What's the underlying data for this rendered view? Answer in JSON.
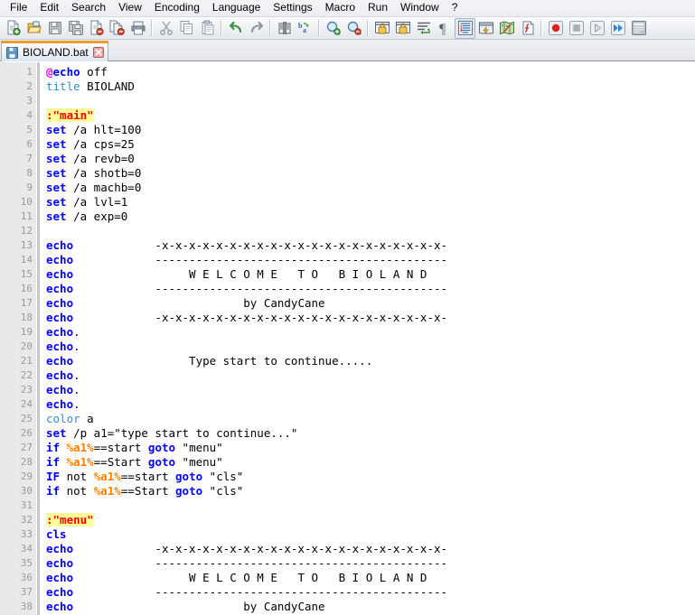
{
  "app": {
    "title": "Notepad++",
    "accent_orange": "#f09a2b",
    "label_color": "#ff0000",
    "keyword_color": "#0000ff",
    "variable_color": "#ff8000",
    "highlight_color": "#ffff99"
  },
  "menubar": {
    "items": [
      {
        "label": "File",
        "name": "menu-file"
      },
      {
        "label": "Edit",
        "name": "menu-edit"
      },
      {
        "label": "Search",
        "name": "menu-search"
      },
      {
        "label": "View",
        "name": "menu-view"
      },
      {
        "label": "Encoding",
        "name": "menu-encoding"
      },
      {
        "label": "Language",
        "name": "menu-language"
      },
      {
        "label": "Settings",
        "name": "menu-settings"
      },
      {
        "label": "Macro",
        "name": "menu-macro"
      },
      {
        "label": "Run",
        "name": "menu-run"
      },
      {
        "label": "Window",
        "name": "menu-window"
      },
      {
        "label": "?",
        "name": "menu-help"
      }
    ]
  },
  "toolbar": {
    "buttons": [
      {
        "icon": "new-file-icon",
        "tooltip": "New"
      },
      {
        "icon": "open-file-icon",
        "tooltip": "Open"
      },
      {
        "icon": "save-icon",
        "tooltip": "Save"
      },
      {
        "icon": "save-all-icon",
        "tooltip": "Save All"
      },
      {
        "icon": "close-file-icon",
        "tooltip": "Close"
      },
      {
        "icon": "close-all-files-icon",
        "tooltip": "Close All"
      },
      {
        "icon": "print-icon",
        "tooltip": "Print"
      },
      {
        "icon": "separator",
        "tooltip": ""
      },
      {
        "icon": "cut-icon",
        "tooltip": "Cut"
      },
      {
        "icon": "copy-icon",
        "tooltip": "Copy"
      },
      {
        "icon": "paste-icon",
        "tooltip": "Paste"
      },
      {
        "icon": "separator",
        "tooltip": ""
      },
      {
        "icon": "undo-icon",
        "tooltip": "Undo"
      },
      {
        "icon": "redo-icon",
        "tooltip": "Redo"
      },
      {
        "icon": "separator",
        "tooltip": ""
      },
      {
        "icon": "find-icon",
        "tooltip": "Find"
      },
      {
        "icon": "replace-icon",
        "tooltip": "Replace"
      },
      {
        "icon": "separator",
        "tooltip": ""
      },
      {
        "icon": "zoom-in-icon",
        "tooltip": "Zoom In"
      },
      {
        "icon": "zoom-out-icon",
        "tooltip": "Zoom Out"
      },
      {
        "icon": "separator",
        "tooltip": ""
      },
      {
        "icon": "sync-vertical-scroll-icon",
        "tooltip": "Synchronize Vertical Scrolling"
      },
      {
        "icon": "sync-horizontal-scroll-icon",
        "tooltip": "Synchronize Horizontal Scrolling"
      },
      {
        "icon": "word-wrap-icon",
        "tooltip": "Word Wrap"
      },
      {
        "icon": "show-all-chars-icon",
        "tooltip": "Show All Characters"
      },
      {
        "icon": "indent-guide-icon",
        "tooltip": "Show Indent Guide"
      },
      {
        "icon": "user-defined-dialog-icon",
        "tooltip": "User Defined Dialogue"
      },
      {
        "icon": "show-document-map-icon",
        "tooltip": "Document Map"
      },
      {
        "icon": "function-list-icon",
        "tooltip": "Function List"
      },
      {
        "icon": "separator",
        "tooltip": ""
      },
      {
        "icon": "record-macro-icon",
        "tooltip": "Start Recording"
      },
      {
        "icon": "stop-macro-icon",
        "tooltip": "Stop Recording"
      },
      {
        "icon": "play-macro-icon",
        "tooltip": "Playback"
      },
      {
        "icon": "run-macro-multiple-icon",
        "tooltip": "Run a Macro Multiple Times"
      },
      {
        "icon": "save-macro-icon",
        "tooltip": "Save Current Recorded Macro"
      }
    ]
  },
  "tabbar": {
    "tabs": [
      {
        "label": "BIOLAND.bat",
        "icon": "saved-file-icon",
        "close_icon": "close-icon",
        "active": true
      }
    ]
  },
  "editor": {
    "first_line": 1,
    "total_visible_lines": 38,
    "lines": [
      {
        "n": 1,
        "tokens": [
          {
            "t": "@",
            "c": "at"
          },
          {
            "t": "echo",
            "c": "k"
          },
          {
            "t": " off",
            "c": "txt"
          }
        ]
      },
      {
        "n": 2,
        "tokens": [
          {
            "t": "title",
            "c": "k2"
          },
          {
            "t": " BIOLAND",
            "c": "txt"
          }
        ]
      },
      {
        "n": 3,
        "tokens": []
      },
      {
        "n": 4,
        "tokens": [
          {
            "t": ":\"main\"",
            "c": "lbl"
          }
        ]
      },
      {
        "n": 5,
        "tokens": [
          {
            "t": "set",
            "c": "k"
          },
          {
            "t": " /a hlt=100",
            "c": "txt"
          }
        ]
      },
      {
        "n": 6,
        "tokens": [
          {
            "t": "set",
            "c": "k"
          },
          {
            "t": " /a cps=25",
            "c": "txt"
          }
        ]
      },
      {
        "n": 7,
        "tokens": [
          {
            "t": "set",
            "c": "k"
          },
          {
            "t": " /a revb=0",
            "c": "txt"
          }
        ]
      },
      {
        "n": 8,
        "tokens": [
          {
            "t": "set",
            "c": "k"
          },
          {
            "t": " /a shotb=0",
            "c": "txt"
          }
        ]
      },
      {
        "n": 9,
        "tokens": [
          {
            "t": "set",
            "c": "k"
          },
          {
            "t": " /a machb=0",
            "c": "txt"
          }
        ]
      },
      {
        "n": 10,
        "tokens": [
          {
            "t": "set",
            "c": "k"
          },
          {
            "t": " /a lvl=1",
            "c": "txt"
          }
        ]
      },
      {
        "n": 11,
        "tokens": [
          {
            "t": "set",
            "c": "k"
          },
          {
            "t": " /a exp=0",
            "c": "txt"
          }
        ]
      },
      {
        "n": 12,
        "tokens": []
      },
      {
        "n": 13,
        "tokens": [
          {
            "t": "echo",
            "c": "k"
          },
          {
            "t": "            -x-x-x-x-x-x-x-x-x-x-x-x-x-x-x-x-x-x-x-x-x-",
            "c": "txt"
          }
        ]
      },
      {
        "n": 14,
        "tokens": [
          {
            "t": "echo",
            "c": "k"
          },
          {
            "t": "            -------------------------------------------",
            "c": "txt"
          }
        ]
      },
      {
        "n": 15,
        "tokens": [
          {
            "t": "echo",
            "c": "k"
          },
          {
            "t": "                 W E L C O M E   T O   B I O L A N D",
            "c": "txt"
          }
        ]
      },
      {
        "n": 16,
        "tokens": [
          {
            "t": "echo",
            "c": "k"
          },
          {
            "t": "            -------------------------------------------",
            "c": "txt"
          }
        ]
      },
      {
        "n": 17,
        "tokens": [
          {
            "t": "echo",
            "c": "k"
          },
          {
            "t": "                         by CandyCane",
            "c": "txt"
          }
        ]
      },
      {
        "n": 18,
        "tokens": [
          {
            "t": "echo",
            "c": "k"
          },
          {
            "t": "            -x-x-x-x-x-x-x-x-x-x-x-x-x-x-x-x-x-x-x-x-x-",
            "c": "txt"
          }
        ]
      },
      {
        "n": 19,
        "tokens": [
          {
            "t": "echo",
            "c": "k"
          },
          {
            "t": ".",
            "c": "txt"
          }
        ]
      },
      {
        "n": 20,
        "tokens": [
          {
            "t": "echo",
            "c": "k"
          },
          {
            "t": ".",
            "c": "txt"
          }
        ]
      },
      {
        "n": 21,
        "tokens": [
          {
            "t": "echo",
            "c": "k"
          },
          {
            "t": "                 Type start to continue.....",
            "c": "txt"
          }
        ]
      },
      {
        "n": 22,
        "tokens": [
          {
            "t": "echo",
            "c": "k"
          },
          {
            "t": ".",
            "c": "txt"
          }
        ]
      },
      {
        "n": 23,
        "tokens": [
          {
            "t": "echo",
            "c": "k"
          },
          {
            "t": ".",
            "c": "txt"
          }
        ]
      },
      {
        "n": 24,
        "tokens": [
          {
            "t": "echo",
            "c": "k"
          },
          {
            "t": ".",
            "c": "txt"
          }
        ]
      },
      {
        "n": 25,
        "tokens": [
          {
            "t": "color",
            "c": "k2"
          },
          {
            "t": " a",
            "c": "txt"
          }
        ]
      },
      {
        "n": 26,
        "tokens": [
          {
            "t": "set",
            "c": "k"
          },
          {
            "t": " /p a1=\"type start to continue...\"",
            "c": "txt"
          }
        ]
      },
      {
        "n": 27,
        "tokens": [
          {
            "t": "if",
            "c": "k"
          },
          {
            "t": " ",
            "c": "txt"
          },
          {
            "t": "%a1%",
            "c": "var"
          },
          {
            "t": "==start ",
            "c": "txt"
          },
          {
            "t": "goto",
            "c": "k"
          },
          {
            "t": " \"menu\"",
            "c": "txt"
          }
        ]
      },
      {
        "n": 28,
        "tokens": [
          {
            "t": "if",
            "c": "k"
          },
          {
            "t": " ",
            "c": "txt"
          },
          {
            "t": "%a1%",
            "c": "var"
          },
          {
            "t": "==Start ",
            "c": "txt"
          },
          {
            "t": "goto",
            "c": "k"
          },
          {
            "t": " \"menu\"",
            "c": "txt"
          }
        ]
      },
      {
        "n": 29,
        "tokens": [
          {
            "t": "IF",
            "c": "k"
          },
          {
            "t": " not ",
            "c": "txt"
          },
          {
            "t": "%a1%",
            "c": "var"
          },
          {
            "t": "==start ",
            "c": "txt"
          },
          {
            "t": "goto",
            "c": "k"
          },
          {
            "t": " \"cls\"",
            "c": "txt"
          }
        ]
      },
      {
        "n": 30,
        "tokens": [
          {
            "t": "if",
            "c": "k"
          },
          {
            "t": " not ",
            "c": "txt"
          },
          {
            "t": "%a1%",
            "c": "var"
          },
          {
            "t": "==Start ",
            "c": "txt"
          },
          {
            "t": "goto",
            "c": "k"
          },
          {
            "t": " \"cls\"",
            "c": "txt"
          }
        ]
      },
      {
        "n": 31,
        "tokens": []
      },
      {
        "n": 32,
        "tokens": [
          {
            "t": ":\"menu\"",
            "c": "lbl"
          }
        ]
      },
      {
        "n": 33,
        "tokens": [
          {
            "t": "cls",
            "c": "k"
          }
        ]
      },
      {
        "n": 34,
        "tokens": [
          {
            "t": "echo",
            "c": "k"
          },
          {
            "t": "            -x-x-x-x-x-x-x-x-x-x-x-x-x-x-x-x-x-x-x-x-x-",
            "c": "txt"
          }
        ]
      },
      {
        "n": 35,
        "tokens": [
          {
            "t": "echo",
            "c": "k"
          },
          {
            "t": "            -------------------------------------------",
            "c": "txt"
          }
        ]
      },
      {
        "n": 36,
        "tokens": [
          {
            "t": "echo",
            "c": "k"
          },
          {
            "t": "                 W E L C O M E   T O   B I O L A N D",
            "c": "txt"
          }
        ]
      },
      {
        "n": 37,
        "tokens": [
          {
            "t": "echo",
            "c": "k"
          },
          {
            "t": "            -------------------------------------------",
            "c": "txt"
          }
        ]
      },
      {
        "n": 38,
        "tokens": [
          {
            "t": "echo",
            "c": "k"
          },
          {
            "t": "                         by CandyCane",
            "c": "txt"
          }
        ]
      }
    ]
  }
}
